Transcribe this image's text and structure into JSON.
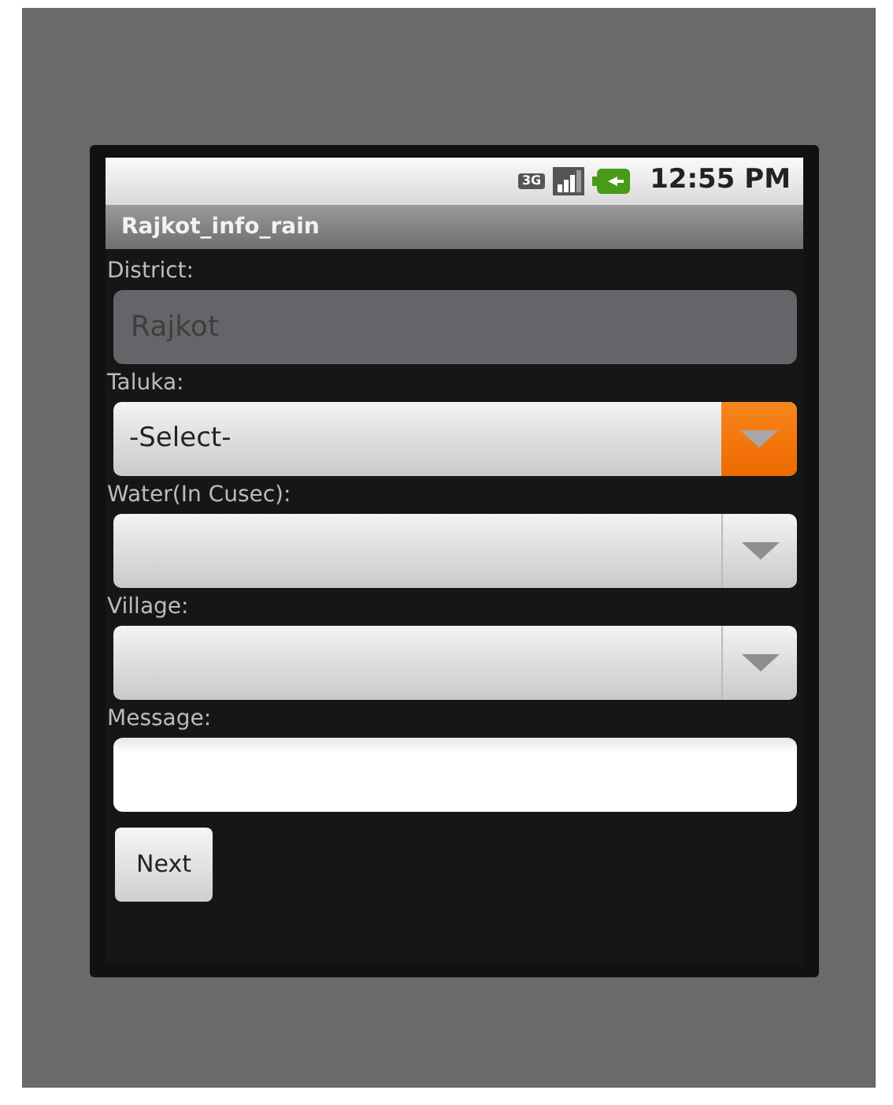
{
  "status_bar": {
    "network": "3G",
    "time": "12:55 PM"
  },
  "title_bar": {
    "title": "Rajkot_info_rain"
  },
  "fields": [
    {
      "kind": "text",
      "label": "District:",
      "value": "Rajkot",
      "disabled": true
    },
    {
      "kind": "spinner",
      "label": "Taluka:",
      "value": "-Select-",
      "focused": true
    },
    {
      "kind": "spinner",
      "label": "Water(In Cusec):",
      "focused": false
    },
    {
      "kind": "spinner",
      "label": "Village:",
      "focused": false
    },
    {
      "kind": "text",
      "label": "Message:",
      "disabled": false
    }
  ],
  "buttons": [
    "Next"
  ]
}
